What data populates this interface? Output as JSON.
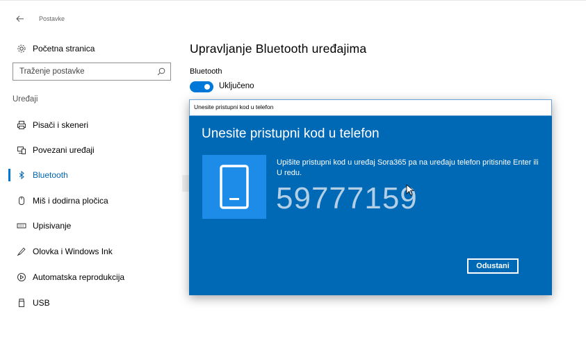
{
  "app": {
    "title": "Postavke"
  },
  "sidebar": {
    "home": "Početna stranica",
    "search_placeholder": "Traženje postavke",
    "section": "Uređaji",
    "items": [
      {
        "label": "Pisači i skeneri",
        "icon": "printer-icon"
      },
      {
        "label": "Povezani uređaji",
        "icon": "connected-devices-icon"
      },
      {
        "label": "Bluetooth",
        "icon": "bluetooth-icon",
        "active": true
      },
      {
        "label": "Miš i dodirna pločica",
        "icon": "mouse-icon"
      },
      {
        "label": "Upisivanje",
        "icon": "keyboard-icon"
      },
      {
        "label": "Olovka i Windows Ink",
        "icon": "pen-icon"
      },
      {
        "label": "Automatska reprodukcija",
        "icon": "autoplay-icon"
      },
      {
        "label": "USB",
        "icon": "usb-icon"
      }
    ]
  },
  "main": {
    "title": "Upravljanje Bluetooth uređajima",
    "bluetooth_label": "Bluetooth",
    "toggle_state": "Uključeno"
  },
  "dialog": {
    "window_title": "Unesite pristupni kod u telefon",
    "heading": "Unesite pristupni kod u telefon",
    "message": "Upišite pristupni kod u uređaj Sora365 pa na uređaju telefon pritisnite Enter ili U redu.",
    "code": "59777159",
    "cancel_label": "Odustani"
  },
  "colors": {
    "accent": "#0078d7",
    "dialog_bg": "#0069b6",
    "tile_bg": "#1c8ce8"
  }
}
